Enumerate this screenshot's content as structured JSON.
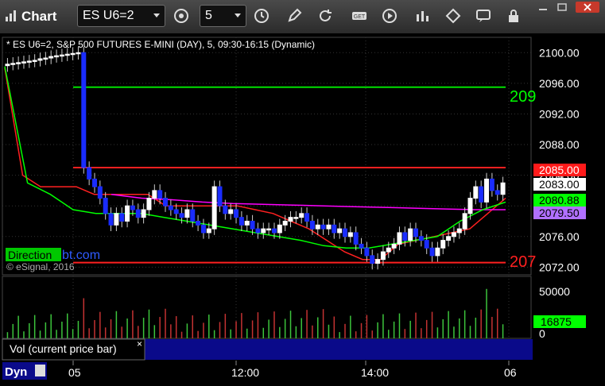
{
  "app": {
    "title": "Chart"
  },
  "toolbar": {
    "symbol": "ES U6=2",
    "interval": "5"
  },
  "chart": {
    "header": "* ES U6=2, S&P 500 FUTURES E-MINI (DAY), 5, 09:30-16:15 (Dynamic)",
    "copyright": "© eSignal, 2016",
    "watermark_left": "Direction",
    "watermark_right": "bt.com",
    "price_ticks": [
      "2100.00",
      "2096.00",
      "2092.00",
      "2088.00",
      "2084.00",
      "2080.00",
      "2076.00",
      "2072.00"
    ],
    "time_ticks": [
      "05",
      "12:00",
      "14:00",
      "06"
    ],
    "last_price": "2083.00",
    "badge_red": "2085.00",
    "badge_green": "2080.88",
    "badge_purple": "2079.50",
    "line_label_green": "209",
    "line_label_red": "207",
    "volume_tick": "50000",
    "volume_zero": "0",
    "volume_badge": "16875",
    "study_label": "Vol (current price bar)",
    "study_close": "×",
    "bottom_label": "Dyn"
  },
  "chart_data": {
    "type": "candlestick",
    "symbol": "ES U6=2",
    "interval": "5",
    "ylim": [
      2071,
      2102
    ],
    "levels": {
      "green_upper": 2095.5,
      "red_upper": 2085.0,
      "red_lower": 2072.6
    },
    "closes": [
      2098.5,
      2098.6,
      2098.7,
      2098.8,
      2098.9,
      2099.0,
      2099.2,
      2099.3,
      2099.5,
      2099.6,
      2099.7,
      2099.8,
      2099.9,
      2100.0,
      2085.0,
      2083.5,
      2082.5,
      2081.0,
      2079.0,
      2077.5,
      2079.0,
      2078.0,
      2080.0,
      2079.5,
      2078.5,
      2079.5,
      2081.0,
      2082.0,
      2081.0,
      2080.0,
      2079.5,
      2079.0,
      2078.5,
      2079.5,
      2078.0,
      2077.5,
      2076.5,
      2077.0,
      2082.5,
      2080.0,
      2079.0,
      2079.5,
      2078.5,
      2077.5,
      2078.0,
      2077.0,
      2076.5,
      2077.0,
      2077.0,
      2076.5,
      2077.5,
      2078.0,
      2078.5,
      2078.5,
      2079.0,
      2078.0,
      2077.0,
      2077.5,
      2077.0,
      2077.5,
      2076.5,
      2077.0,
      2076.0,
      2076.5,
      2075.0,
      2074.5,
      2073.5,
      2072.5,
      2073.0,
      2074.0,
      2074.5,
      2075.0,
      2076.5,
      2075.5,
      2077.0,
      2076.0,
      2075.5,
      2074.5,
      2073.5,
      2074.5,
      2075.5,
      2076.0,
      2076.5,
      2077.0,
      2079.0,
      2081.0,
      2082.5,
      2080.5,
      2083.5,
      2082.0,
      2081.5,
      2083.0
    ],
    "moving_averages": [
      {
        "color": "#ff2020",
        "values": [
          2098.0,
          2084.0,
          2082.5,
          2082.5,
          2082.5,
          2081.5,
          2081.5,
          2081.5,
          2081.5,
          2080.0,
          2080.0,
          2080.0,
          2080.0,
          2080.0,
          2079.5,
          2079.0,
          2078.0,
          2077.0,
          2075.5,
          2074.0,
          2073.0,
          2073.0,
          2075.0,
          2075.5,
          2076.0,
          2076.5,
          2077.0,
          2079.0,
          2081.0
        ]
      },
      {
        "color": "#ff00ff",
        "values": [
          2081.5,
          2081.0,
          2080.8,
          2080.5,
          2080.3,
          2080.2,
          2080.1,
          2080.0,
          2079.9,
          2079.8,
          2079.7,
          2079.6,
          2079.5,
          2079.5
        ]
      },
      {
        "color": "#00ff00",
        "values": [
          2098.2,
          2083.0,
          2081.5,
          2079.5,
          2079.0,
          2079.0,
          2079.0,
          2078.5,
          2078.0,
          2077.5,
          2077.0,
          2076.5,
          2076.0,
          2075.5,
          2074.8,
          2074.5,
          2074.5,
          2075.0,
          2075.5,
          2076.0,
          2078.0,
          2079.5,
          2080.5
        ]
      }
    ],
    "volume_ylim": [
      0,
      60000
    ],
    "last_volume": 16875
  }
}
